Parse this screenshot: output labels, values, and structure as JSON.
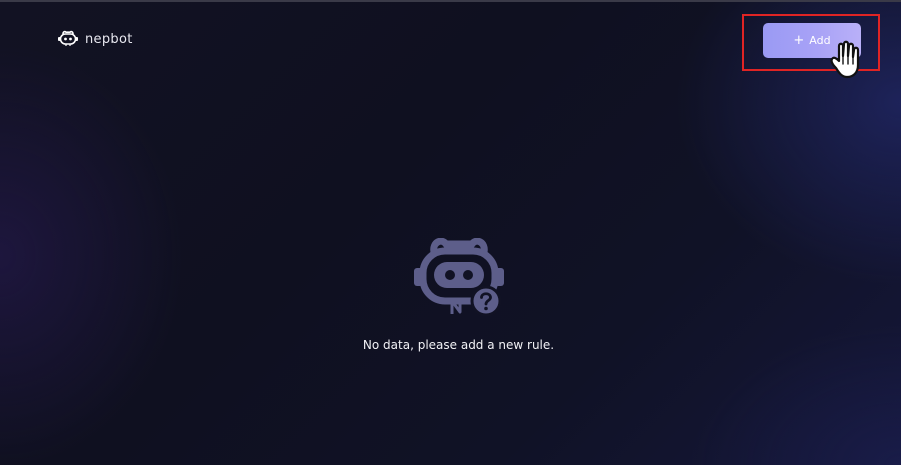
{
  "header": {
    "logo_text": "nepbot",
    "logo_icon": "robot-head-icon"
  },
  "toolbar": {
    "add_icon": "+",
    "add_label": "Add"
  },
  "empty_state": {
    "icon": "robot-question-icon",
    "message": "No data, please add a new rule."
  },
  "colors": {
    "background": "#111224",
    "button_gradient_start": "#9a9af4",
    "button_gradient_end": "#b9b0f8",
    "highlight_border": "#e02424",
    "robot_icon": "#5d5e8a"
  }
}
